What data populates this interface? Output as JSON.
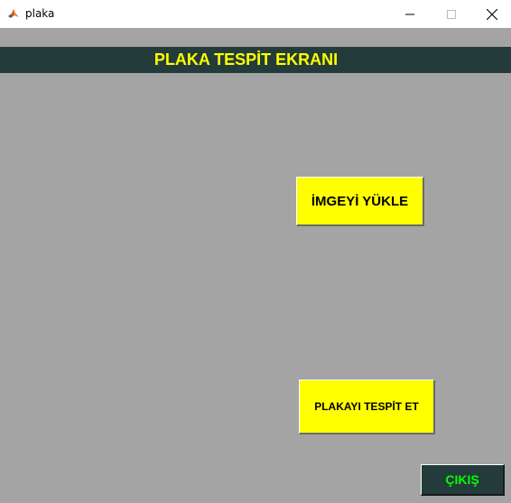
{
  "window": {
    "title": "plaka",
    "app_icon": "matlab-icon",
    "controls": [
      "minimize-icon",
      "maximize-icon",
      "close-icon"
    ]
  },
  "header": {
    "title": "PLAKA TESPİT EKRANI",
    "text_color": "#ffff00",
    "background": "#243b3b"
  },
  "buttons": {
    "load_image": "İMGEYİ YÜKLE",
    "detect_plate": "PLAKAYI TESPİT ET",
    "exit": "ÇIKIŞ"
  },
  "colors": {
    "background": "#a4a4a4",
    "yellow_button": "#ffff00",
    "exit_button_bg": "#243b3b",
    "exit_button_text": "#00ff00"
  }
}
